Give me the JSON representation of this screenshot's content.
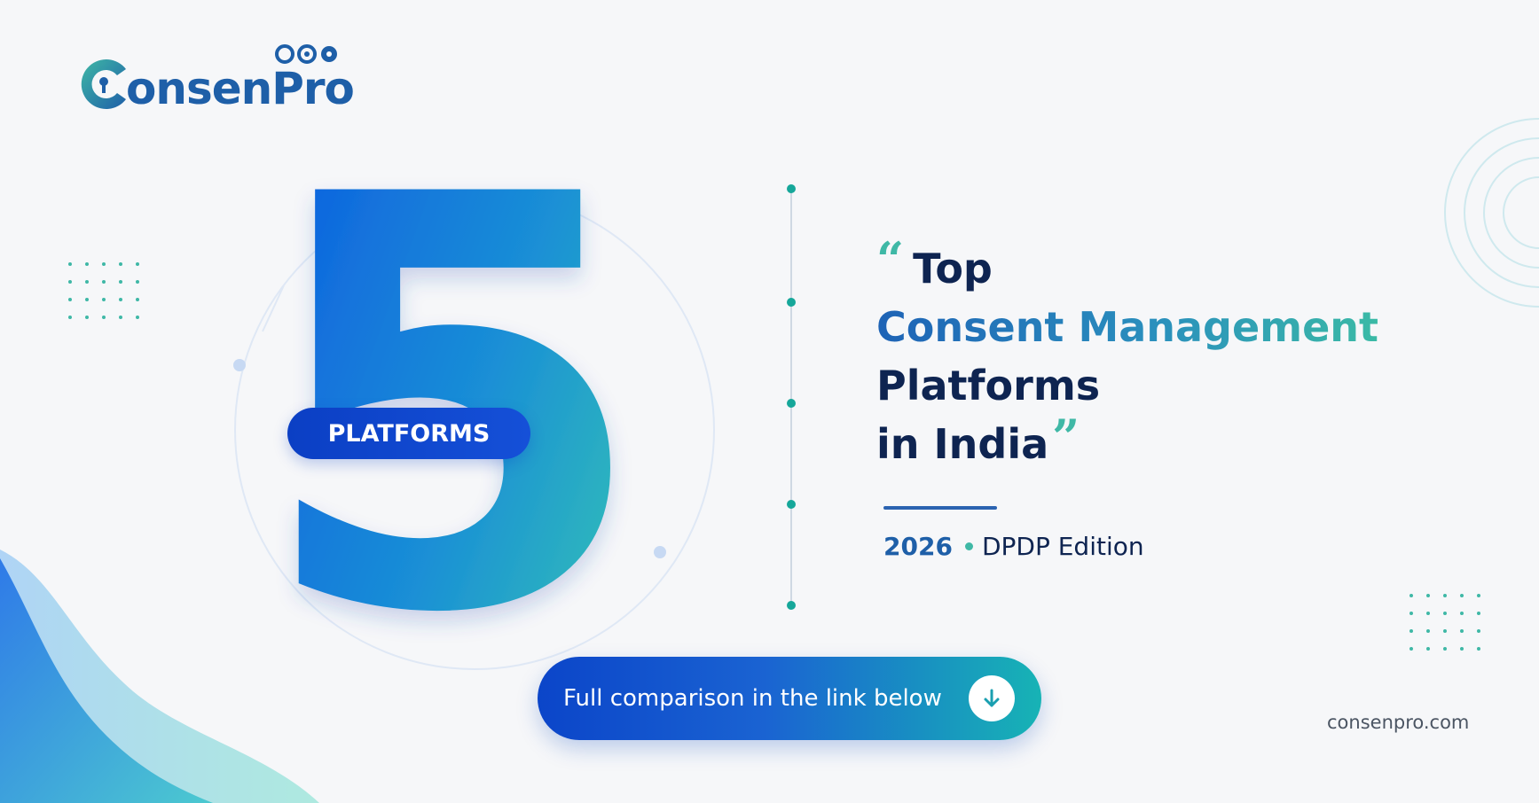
{
  "logo": {
    "text": "onsenPro",
    "icon": "keyhole-c-logo-icon"
  },
  "hero": {
    "number": "5",
    "badge": "PLATFORMS"
  },
  "headline": {
    "line1": "Top",
    "line2": "Consent Management",
    "line3": "Platforms",
    "line4": "in India",
    "open_quote": "“",
    "close_quote": "”"
  },
  "edition": {
    "year": "2026",
    "label": "DPDP Edition"
  },
  "cta": {
    "label": "Full comparison in the link below",
    "icon": "arrow-down-icon"
  },
  "footer": {
    "website": "consenpro.com"
  },
  "colors": {
    "navy": "#0e2451",
    "brand_blue": "#1e5fa8",
    "teal": "#3fb8a6",
    "cta_start": "#0b45c9",
    "cta_end": "#17b3b5"
  }
}
